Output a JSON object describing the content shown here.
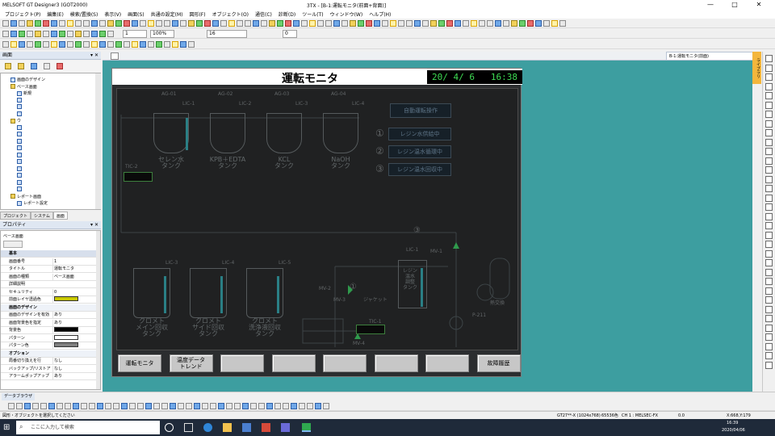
{
  "window": {
    "app_title": "MELSOFT GT Designer3 (GOT2000)",
    "doc_title": "3TX - [B-1:運転モニタ(前面+背面)]",
    "minimize": "—",
    "maximize": "□",
    "close": "✕"
  },
  "menu": [
    "プロジェクト(P)",
    "編集(E)",
    "検索/置換(S)",
    "表示(V)",
    "画面(S)",
    "共通の設定(M)",
    "図形(F)",
    "オブジェクト(O)",
    "通信(C)",
    "診断(D)",
    "ツール(T)",
    "ウィンドウ(W)",
    "ヘルプ(H)"
  ],
  "toolbar": {
    "zoom": "100%",
    "layer": "1",
    "font_size": "16",
    "line_width": "0"
  },
  "screen_panel": {
    "title": "画面",
    "tree": [
      {
        "label": "画面のデザイン",
        "indent": 1,
        "icon": "doc"
      },
      {
        "label": "ベース画面",
        "indent": 1,
        "icon": "folder"
      },
      {
        "label": "新規",
        "indent": 2,
        "icon": "doc"
      },
      {
        "label": "",
        "indent": 2,
        "icon": "doc"
      },
      {
        "label": "",
        "indent": 2,
        "icon": "doc"
      },
      {
        "label": "",
        "indent": 2,
        "icon": "doc"
      },
      {
        "label": "ウ",
        "indent": 1,
        "icon": "folder"
      },
      {
        "label": "",
        "indent": 2,
        "icon": "doc"
      },
      {
        "label": "",
        "indent": 2,
        "icon": "doc"
      },
      {
        "label": "",
        "indent": 2,
        "icon": "doc"
      },
      {
        "label": "",
        "indent": 2,
        "icon": "doc"
      },
      {
        "label": "",
        "indent": 2,
        "icon": "doc"
      },
      {
        "label": "",
        "indent": 2,
        "icon": "doc"
      },
      {
        "label": "",
        "indent": 2,
        "icon": "doc"
      },
      {
        "label": "",
        "indent": 2,
        "icon": "doc"
      },
      {
        "label": "",
        "indent": 2,
        "icon": "doc"
      },
      {
        "label": "",
        "indent": 2,
        "icon": "doc"
      },
      {
        "label": "レポート画面",
        "indent": 1,
        "icon": "folder"
      },
      {
        "label": "レポート設定",
        "indent": 2,
        "icon": "doc"
      }
    ]
  },
  "left_tabs": [
    "プロジェクト",
    "システム",
    "画面"
  ],
  "property_panel": {
    "title": "プロパティ",
    "object": "ベース画面",
    "rows": [
      {
        "key": "基本",
        "value": "",
        "type": "sec"
      },
      {
        "key": "画面番号",
        "value": "1",
        "type": ""
      },
      {
        "key": "タイトル",
        "value": "運転モニタ",
        "type": ""
      },
      {
        "key": "画面の種類",
        "value": "ベース画面",
        "type": ""
      },
      {
        "key": "詳細説明",
        "value": "",
        "type": ""
      },
      {
        "key": "セキュリティ",
        "value": "0",
        "type": ""
      },
      {
        "key": "前面レイヤ透過色",
        "value": "",
        "type": "color",
        "color": "#c8c800"
      },
      {
        "key": "画面のデザイン",
        "value": "",
        "type": "sub"
      },
      {
        "key": "画面のデザインを有効",
        "value": "あり",
        "type": ""
      },
      {
        "key": "画面背景色を指定",
        "value": "あり",
        "type": ""
      },
      {
        "key": "背景色",
        "value": "",
        "type": "color",
        "color": "#000000"
      },
      {
        "key": "パターン",
        "value": "",
        "type": "color",
        "color": "#ffffff"
      },
      {
        "key": "パターン色",
        "value": "",
        "type": "color",
        "color": "#808080"
      },
      {
        "key": "オプション",
        "value": "",
        "type": "sub"
      },
      {
        "key": "局番切り換えを行",
        "value": "なし",
        "type": ""
      },
      {
        "key": "バックアップ/リストア",
        "value": "なし",
        "type": ""
      },
      {
        "key": "アラームポップアップ",
        "value": "あり",
        "type": ""
      }
    ]
  },
  "data_browser": {
    "title": "データブラウザ"
  },
  "status": {
    "message": "図形・オブジェクトを選択してください",
    "got": "GT27**-X (1024x768)",
    "colors": "65536色",
    "ch": "CH 1 : MELSEC-FX",
    "zoom": "0.0",
    "coords": "X:668,Y:179"
  },
  "taskbar": {
    "search_placeholder": "ここに入力して検索",
    "time": "16:39",
    "date": "2020/04/06"
  },
  "doc_tab": {
    "label": "B-1:運転モニタ(前面)"
  },
  "right_panel": {
    "library_tab": "ライブラリ"
  },
  "hmi": {
    "title": "運転モニタ",
    "datetime": "20/ 4/ 6   16:38",
    "tanks_top": [
      {
        "tag": "AG-01",
        "lic": "LIC-1",
        "label": "セレン水\nタンク"
      },
      {
        "tag": "AG-02",
        "lic": "LIC-2",
        "label": "KPB＋EDTA\nタンク"
      },
      {
        "tag": "AG-03",
        "lic": "LIC-3",
        "label": "KCL\nタンク"
      },
      {
        "tag": "AG-04",
        "lic": "LIC-4",
        "label": "NaOH\nタンク"
      }
    ],
    "tanks_bottom": [
      {
        "lic": "LIC-3",
        "label": "クロメト\nメイン回収\nタンク"
      },
      {
        "lic": "LIC-4",
        "label": "クロメト\nサイド回収\nタンク"
      },
      {
        "lic": "LIC-5",
        "label": "クロメト\n洗浄液回収\nタンク"
      }
    ],
    "auto_button": "自動運転操作",
    "steps": [
      {
        "num": "①",
        "label": "レジン水供給中"
      },
      {
        "num": "②",
        "label": "レジン温水循環中"
      },
      {
        "num": "③",
        "label": "レジン温水回収中"
      }
    ],
    "tic2": "TIC-2",
    "tic1": "TIC-1",
    "lic_center": "LIC-1",
    "tank_center": "レジン\n温水\n調整\nタンク",
    "pump_label": "P-211",
    "hx_label": "熱交換",
    "mv_labels": [
      "MV-1",
      "MV-2",
      "MV-3",
      "MV-4"
    ],
    "step4": "③",
    "sub_label": "ジャケット",
    "nav_buttons": [
      "運転モニタ",
      "温度データ\nトレンド",
      "",
      "",
      "",
      "",
      "",
      "故障履歴"
    ]
  }
}
